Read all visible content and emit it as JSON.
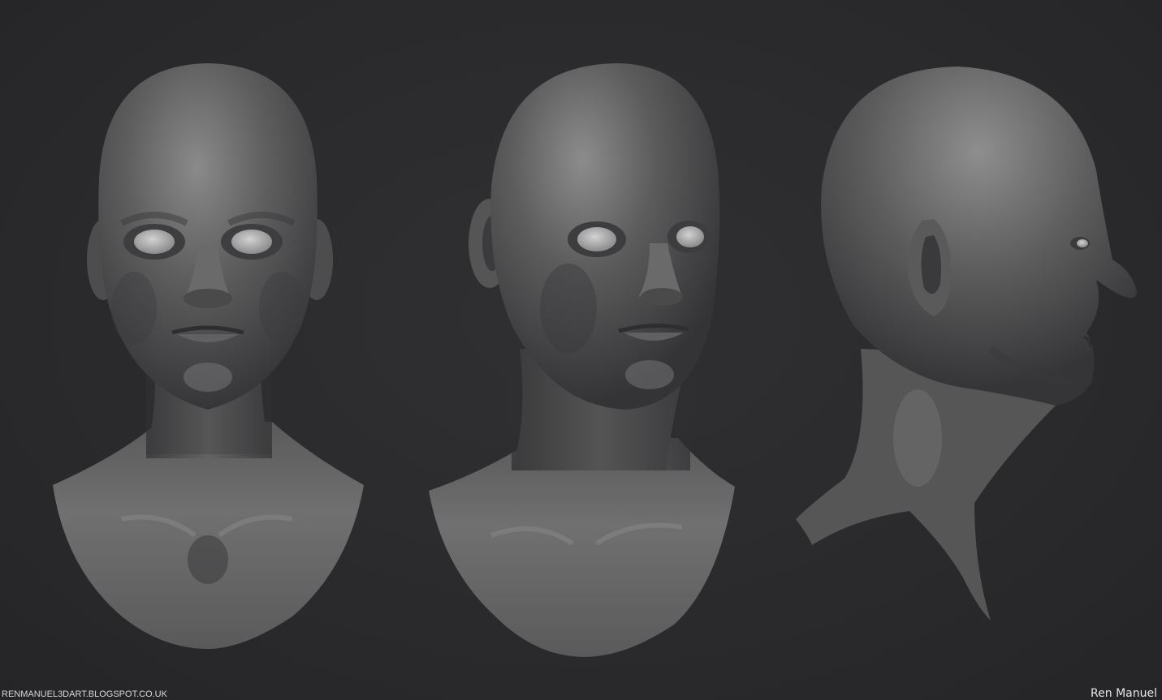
{
  "image": {
    "subject": "three views of a bald sculpted female head bust",
    "views": [
      "front",
      "three-quarter",
      "side-profile"
    ],
    "palette": {
      "background": "#2b2b2d",
      "clay_light": "#8c8c8c",
      "clay_mid": "#5e5e5e",
      "clay_dark": "#3a3a3a",
      "text": "#e0e0e0"
    }
  },
  "watermark": {
    "site": "RENMANUEL3DART.BLOGSPOT.CO.UK",
    "artist": "Ren Manuel"
  }
}
